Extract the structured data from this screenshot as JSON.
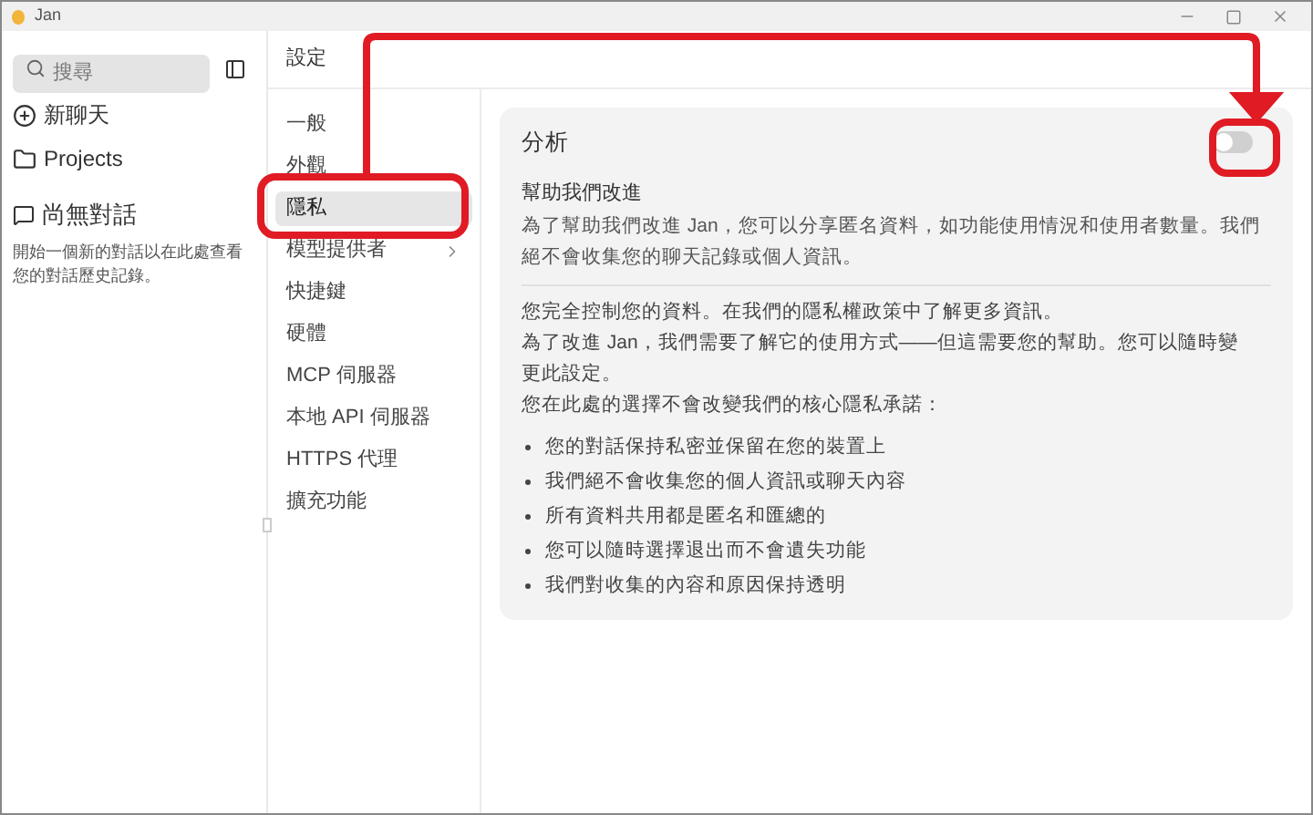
{
  "window": {
    "title": "Jan"
  },
  "sidebar": {
    "search": {
      "placeholder": "搜尋"
    },
    "items": [
      {
        "label": "新聊天",
        "kind": "new"
      },
      {
        "label": "Projects",
        "kind": "folder"
      }
    ],
    "empty": {
      "title": "尚無對話",
      "text": "開始一個新的對話以在此處查看您的對話歷史記錄。"
    }
  },
  "settings": {
    "title": "設定",
    "nav": [
      {
        "label": "一般",
        "selected": false,
        "submenu": false
      },
      {
        "label": "外觀",
        "selected": false,
        "submenu": false
      },
      {
        "label": "隱私",
        "selected": true,
        "submenu": false
      },
      {
        "label": "模型提供者",
        "selected": false,
        "submenu": true
      },
      {
        "label": "快捷鍵",
        "selected": false,
        "submenu": false
      },
      {
        "label": "硬體",
        "selected": false,
        "submenu": false
      },
      {
        "label": "MCP 伺服器",
        "selected": false,
        "submenu": false
      },
      {
        "label": "本地 API 伺服器",
        "selected": false,
        "submenu": false
      },
      {
        "label": "HTTPS 代理",
        "selected": false,
        "submenu": false
      },
      {
        "label": "擴充功能",
        "selected": false,
        "submenu": false
      }
    ],
    "card": {
      "title": "分析",
      "toggle": {
        "on": false
      },
      "heading": "幫助我們改進",
      "description": "為了幫助我們改進 Jan，您可以分享匿名資料，如功能使用情況和使用者數量。我們絕不會收集您的聊天記錄或個人資訊。",
      "paragraphs": [
        "您完全控制您的資料。在我們的隱私權政策中了解更多資訊。",
        "為了改進 Jan，我們需要了解它的使用方式——但這需要您的幫助。您可以隨時變更此設定。",
        "您在此處的選擇不會改變我們的核心隱私承諾："
      ],
      "bullets": [
        "您的對話保持私密並保留在您的裝置上",
        "我們絕不會收集您的個人資訊或聊天內容",
        "所有資料共用都是匿名和匯總的",
        "您可以隨時選擇退出而不會遺失功能",
        "我們對收集的內容和原因保持透明"
      ]
    }
  }
}
